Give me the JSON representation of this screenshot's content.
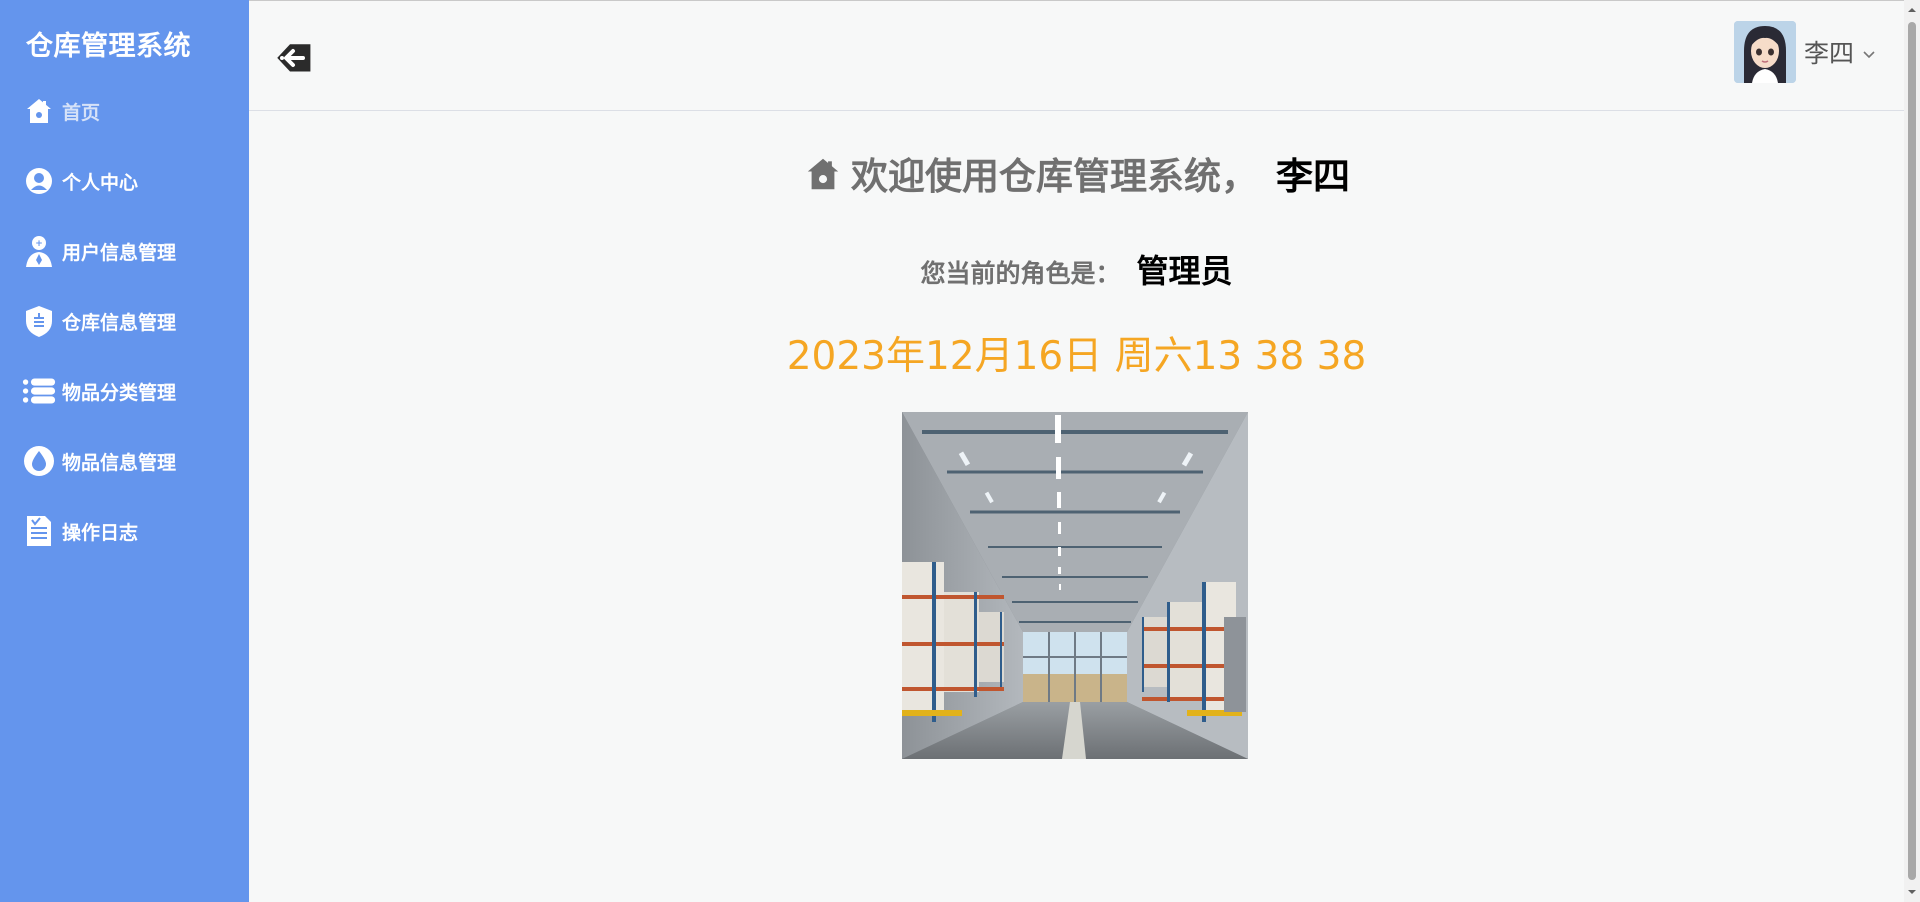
{
  "sidebar": {
    "brand": "仓库管理系统",
    "accent": "#6495ed",
    "items": [
      {
        "label": "首页",
        "icon": "home-icon",
        "active": true
      },
      {
        "label": "个人中心",
        "icon": "user-circle-icon"
      },
      {
        "label": "用户信息管理",
        "icon": "user-admin-icon"
      },
      {
        "label": "仓库信息管理",
        "icon": "shield-icon"
      },
      {
        "label": "物品分类管理",
        "icon": "list-icon"
      },
      {
        "label": "物品信息管理",
        "icon": "drop-icon"
      },
      {
        "label": "操作日志",
        "icon": "document-icon"
      }
    ]
  },
  "header": {
    "collapse_icon": "back-arrow-icon",
    "user": {
      "name": "李四",
      "avatar": "avatar-image",
      "caret": "chevron-down-icon"
    }
  },
  "main": {
    "welcome_text": "欢迎使用仓库管理系统，",
    "welcome_name": "李四",
    "role_label": "您当前的角色是：",
    "role_value": "管理员",
    "datetime": "2023年12月16日 周六13 38 38",
    "datetime_color": "#f5a623",
    "image": "warehouse-photo"
  }
}
